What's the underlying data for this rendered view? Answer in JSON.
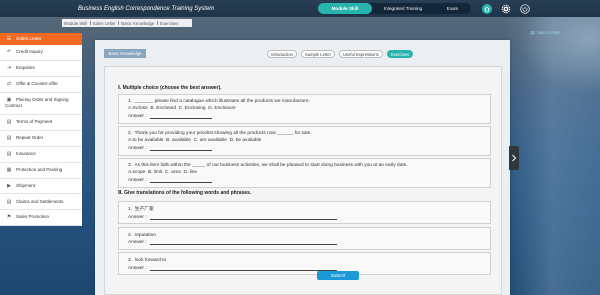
{
  "app": {
    "title": "Business English Correspondence Training System"
  },
  "nav": {
    "tabs": [
      {
        "label": "Module Skill",
        "active": true
      },
      {
        "label": "Integrated Training",
        "active": false
      },
      {
        "label": "Exam",
        "active": false
      }
    ],
    "icons": [
      "home-icon",
      "settings-icon",
      "power-icon"
    ]
  },
  "breadcrumb": {
    "items": [
      "Module Skill",
      "Sales Letter",
      "Basic Knowledge",
      "Exercises"
    ]
  },
  "sidebar": {
    "header": {
      "label": "Sales Letter",
      "icon": "list-icon"
    },
    "items": [
      {
        "label": "Credit Inquiry",
        "icon": "reply-icon"
      },
      {
        "label": "Enquiries",
        "icon": "sign-in-icon"
      },
      {
        "label": "Offer & Counter-offer",
        "icon": "handshake-icon"
      },
      {
        "label": "Placing Order and Signing Contract",
        "icon": "cart-icon"
      },
      {
        "label": "Terms of Payment",
        "icon": "document-icon"
      },
      {
        "label": "Repeat Order",
        "icon": "document-icon"
      },
      {
        "label": "Insurance",
        "icon": "document-icon"
      },
      {
        "label": "Protection and Packing",
        "icon": "box-icon"
      },
      {
        "label": "Shipment",
        "icon": "truck-icon"
      },
      {
        "label": "Claims and Settlements",
        "icon": "document-icon"
      },
      {
        "label": "Sales Promotion",
        "icon": "megaphone-icon"
      }
    ]
  },
  "side_link": {
    "label": "Sales Letter",
    "icon": "document-icon"
  },
  "panel_toggle": {
    "icon": "chevron-right-icon"
  },
  "main": {
    "section_tag": "Basic Knowledge",
    "tabs": [
      {
        "label": "Introduction",
        "active": false
      },
      {
        "label": "Sample Letter",
        "active": false
      },
      {
        "label": "Useful Expressions",
        "active": false
      },
      {
        "label": "Exercises",
        "active": true
      }
    ],
    "part1": {
      "title": "Ⅰ. Multiple choice (choose the best answer).",
      "questions": [
        {
          "text": "1.  _______ please find a catalogue which illustrates all the products we manufacture.",
          "options": "A.Inclose  B. Enclosed  C. Enclosing  D. Enclosure",
          "answer_label": "Answer :"
        },
        {
          "text": "2.  Thank you for providing your pricelist showing all the products now ______ for sale.",
          "options": "A.to be available  B. available  C. are available  D. be available",
          "answer_label": "Answer :"
        },
        {
          "text": "3.  As this item falls within the _____ of our business activities, we shall be pleased to start doing business with you at an early date.",
          "options": "A.scope  B. limit  C. area  D. line",
          "answer_label": "Answer :"
        }
      ]
    },
    "part2": {
      "title": "Ⅱ. Give translations of the following words and phrases.",
      "questions": [
        {
          "text": "1.  生产厂家",
          "answer_label": "Answer :"
        },
        {
          "text": "2.  reputation",
          "answer_label": "Answer :"
        },
        {
          "text": "3.  look forward to",
          "answer_label": "Answer :"
        }
      ]
    },
    "submit_label": "Submit"
  },
  "colors": {
    "header-bg": "#1f3448",
    "nav-bg": "#13263a",
    "accent": "#29b3ad",
    "brand-orange": "#f26a22",
    "submit-blue": "#1b98d6",
    "tag-blue": "#8ba5bf",
    "toggle-bg": "#30373d",
    "link-blue": "#9fd0f0"
  }
}
